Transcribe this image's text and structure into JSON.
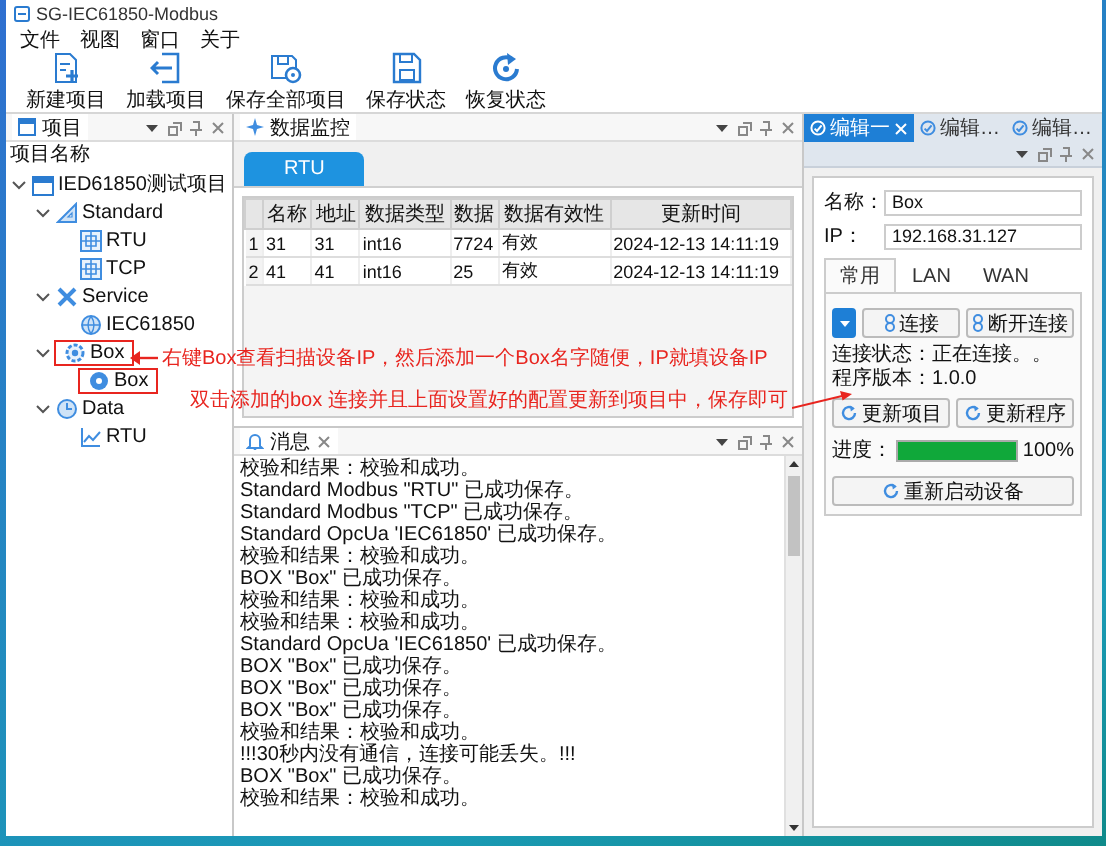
{
  "window": {
    "title": "SG-IEC61850-Modbus"
  },
  "menu": [
    "文件",
    "视图",
    "窗口",
    "关于"
  ],
  "toolbar": [
    {
      "label": "新建项目",
      "kind": "new"
    },
    {
      "label": "加载项目",
      "kind": "load"
    },
    {
      "label": "保存全部项目",
      "kind": "save-all"
    },
    {
      "label": "保存状态",
      "kind": "save"
    },
    {
      "label": "恢复状态",
      "kind": "restore"
    }
  ],
  "project_panel": {
    "title": "项目",
    "header": "项目名称",
    "tree": [
      {
        "label": "IED61850测试项目",
        "kind": "project",
        "expanded": true,
        "highlighted": false,
        "children": [
          {
            "label": "Standard",
            "kind": "standard",
            "expanded": true,
            "highlighted": false,
            "children": [
              {
                "label": "RTU",
                "kind": "node",
                "highlighted": false
              },
              {
                "label": "TCP",
                "kind": "node",
                "highlighted": false
              }
            ]
          },
          {
            "label": "Service",
            "kind": "service",
            "expanded": true,
            "highlighted": false,
            "children": [
              {
                "label": "IEC61850",
                "kind": "opc",
                "highlighted": false
              }
            ]
          },
          {
            "label": "Box",
            "kind": "box",
            "expanded": true,
            "highlighted": true,
            "children": [
              {
                "label": "Box",
                "kind": "device",
                "highlighted": true
              }
            ]
          },
          {
            "label": "Data",
            "kind": "data",
            "expanded": true,
            "highlighted": false,
            "children": [
              {
                "label": "RTU",
                "kind": "chart",
                "highlighted": false
              }
            ]
          }
        ]
      }
    ]
  },
  "monitor": {
    "title": "数据监控",
    "tabs": [
      {
        "label": "RTU",
        "selected": true
      }
    ],
    "table": {
      "columns": [
        "名称",
        "地址",
        "数据类型",
        "数据",
        "数据有效性",
        "更新时间"
      ],
      "rows": [
        {
          "index": "1",
          "cells": [
            "31",
            "31",
            "int16",
            "7724",
            "有效",
            "2024-12-13 14:11:19"
          ]
        },
        {
          "index": "2",
          "cells": [
            "41",
            "41",
            "int16",
            "25",
            "有效",
            "2024-12-13 14:11:19"
          ]
        }
      ]
    }
  },
  "annotations": [
    {
      "text": "右键Box查看扫描设备IP，然后添加一个Box名字随便，IP就填设备IP",
      "kind": "left-arrow"
    },
    {
      "text": "双击添加的box 连接并且上面设置好的配置更新到项目中，保存即可",
      "kind": "right-arrow"
    }
  ],
  "messages": {
    "title": "消息",
    "lines": [
      "校验和结果：校验和成功。",
      "Standard Modbus \"RTU\" 已成功保存。",
      "Standard Modbus \"TCP\" 已成功保存。",
      "Standard OpcUa 'IEC61850' 已成功保存。",
      "校验和结果：校验和成功。",
      "BOX \"Box\" 已成功保存。",
      "校验和结果：校验和成功。",
      "校验和结果：校验和成功。",
      "Standard OpcUa 'IEC61850' 已成功保存。",
      "BOX \"Box\" 已成功保存。",
      "BOX \"Box\" 已成功保存。",
      "BOX \"Box\" 已成功保存。",
      "校验和结果：校验和成功。",
      "!!!30秒内没有通信，连接可能丢失。!!!",
      "BOX \"Box\" 已成功保存。",
      "校验和结果：校验和成功。"
    ]
  },
  "editor": {
    "tabs": [
      {
        "label": "编辑一",
        "selected": true
      },
      {
        "label": "编辑…",
        "selected": false
      },
      {
        "label": "编辑…",
        "selected": false
      }
    ],
    "name_label": "名称：",
    "name_value": "Box",
    "ip_label": "IP：",
    "ip_value": "192.168.31.127",
    "subtabs": [
      {
        "label": "常用",
        "selected": true
      },
      {
        "label": "LAN",
        "selected": false
      },
      {
        "label": "WAN",
        "selected": false
      }
    ],
    "connect": "连接",
    "disconnect": "断开连接",
    "status": "连接状态：正在连接。。",
    "version": "程序版本：1.0.0",
    "update_project": "更新项目",
    "update_program": "更新程序",
    "progress_label": "进度：",
    "progress": {
      "level": 1,
      "reading": "100%"
    },
    "restart": "重新启动设备"
  }
}
